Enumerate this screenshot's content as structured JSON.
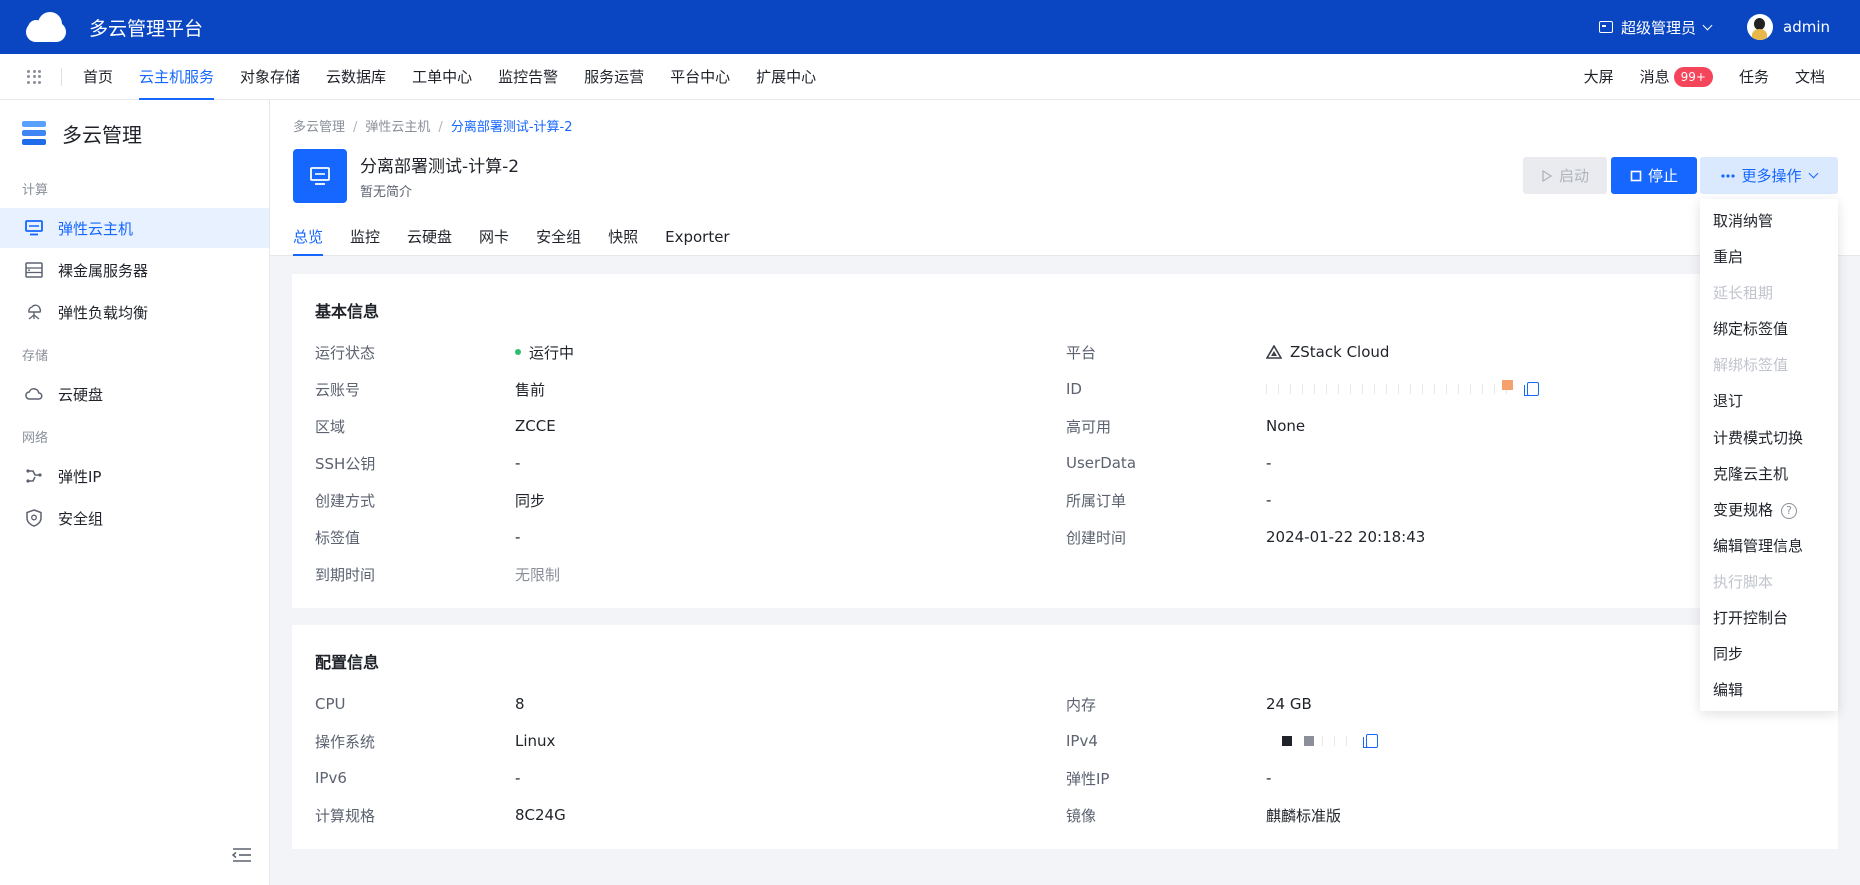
{
  "app": {
    "title": "多云管理平台",
    "role": "超级管理员",
    "user": "admin"
  },
  "nav": {
    "items": [
      "首页",
      "云主机服务",
      "对象存储",
      "云数据库",
      "工单中心",
      "监控告警",
      "服务运营",
      "平台中心",
      "扩展中心"
    ],
    "active_index": 1,
    "right": {
      "screen": "大屏",
      "messages": "消息",
      "message_count": "99+",
      "tasks": "任务",
      "docs": "文档"
    }
  },
  "sidebar": {
    "title": "多云管理",
    "groups": [
      {
        "label": "计算",
        "items": [
          "弹性云主机",
          "裸金属服务器",
          "弹性负载均衡"
        ]
      },
      {
        "label": "存储",
        "items": [
          "云硬盘"
        ]
      },
      {
        "label": "网络",
        "items": [
          "弹性IP",
          "安全组"
        ]
      }
    ],
    "active_item": "弹性云主机"
  },
  "breadcrumb": [
    "多云管理",
    "弹性云主机",
    "分离部署测试-计算-2"
  ],
  "vm": {
    "name": "分离部署测试-计算-2",
    "desc": "暂无简介"
  },
  "actions": {
    "start": "启动",
    "stop": "停止",
    "more": "更多操作"
  },
  "tabs": [
    "总览",
    "监控",
    "云硬盘",
    "网卡",
    "安全组",
    "快照",
    "Exporter"
  ],
  "basic": {
    "title": "基本信息",
    "left": [
      {
        "label": "运行状态",
        "value": "运行中"
      },
      {
        "label": "云账号",
        "value": "售前"
      },
      {
        "label": "区域",
        "value": "ZCCE"
      },
      {
        "label": "SSH公钥",
        "value": "-"
      },
      {
        "label": "创建方式",
        "value": "同步"
      },
      {
        "label": "标签值",
        "value": "-"
      },
      {
        "label": "到期时间",
        "value": "无限制"
      }
    ],
    "right": [
      {
        "label": "平台",
        "value": "ZStack Cloud"
      },
      {
        "label": "ID",
        "value": ""
      },
      {
        "label": "高可用",
        "value": "None"
      },
      {
        "label": "UserData",
        "value": "-"
      },
      {
        "label": "所属订单",
        "value": "-"
      },
      {
        "label": "创建时间",
        "value": "2024-01-22 20:18:43"
      }
    ]
  },
  "config": {
    "title": "配置信息",
    "left": [
      {
        "label": "CPU",
        "value": "8"
      },
      {
        "label": "操作系统",
        "value": "Linux"
      },
      {
        "label": "IPv6",
        "value": "-"
      },
      {
        "label": "计算规格",
        "value": "8C24G"
      }
    ],
    "right": [
      {
        "label": "内存",
        "value": "24 GB"
      },
      {
        "label": "IPv4",
        "value": ""
      },
      {
        "label": "弹性IP",
        "value": "-"
      },
      {
        "label": "镜像",
        "value": "麒麟标准版"
      }
    ]
  },
  "more_menu": [
    {
      "label": "取消纳管",
      "disabled": false
    },
    {
      "label": "重启",
      "disabled": false
    },
    {
      "label": "延长租期",
      "disabled": true
    },
    {
      "label": "绑定标签值",
      "disabled": false
    },
    {
      "label": "解绑标签值",
      "disabled": true
    },
    {
      "label": "退订",
      "disabled": false
    },
    {
      "label": "计费模式切换",
      "disabled": false
    },
    {
      "label": "克隆云主机",
      "disabled": false
    },
    {
      "label": "变更规格",
      "disabled": false
    },
    {
      "label": "编辑管理信息",
      "disabled": false
    },
    {
      "label": "执行脚本",
      "disabled": true
    },
    {
      "label": "打开控制台",
      "disabled": false
    },
    {
      "label": "同步",
      "disabled": false
    },
    {
      "label": "编辑",
      "disabled": false
    }
  ],
  "colors": {
    "topbar": "#0b46c2",
    "accent": "#1667ff",
    "running": "#2dbf6c",
    "badge": "#f5455b"
  }
}
